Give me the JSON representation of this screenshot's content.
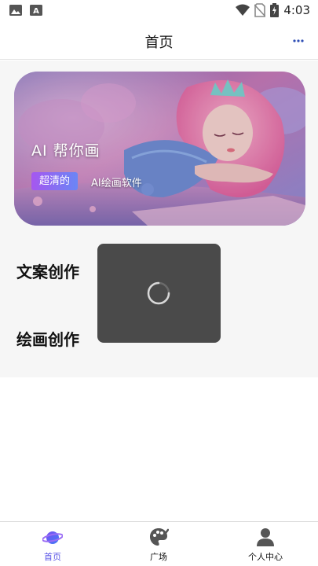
{
  "status_bar": {
    "time": "4:03",
    "icons": [
      "image-icon",
      "text-icon",
      "wifi-icon",
      "no-sim-icon",
      "battery-icon"
    ]
  },
  "header": {
    "title": "首页",
    "more_icon": "ellipsis-icon"
  },
  "banner": {
    "title": "AI 帮你画",
    "tag": "超清的",
    "subtitle": "AI绘画软件"
  },
  "features": {
    "wenan": "文案创作",
    "huihua": "绘画创作"
  },
  "bottom_nav": {
    "items": [
      {
        "label": "首页",
        "icon": "planet-icon",
        "active": true
      },
      {
        "label": "广场",
        "icon": "palette-icon",
        "active": false
      },
      {
        "label": "个人中心",
        "icon": "person-icon",
        "active": false
      }
    ]
  },
  "colors": {
    "accent": "#5a55e6",
    "loading_bg": "#4a4a4a",
    "main_bg": "#f6f6f6"
  }
}
